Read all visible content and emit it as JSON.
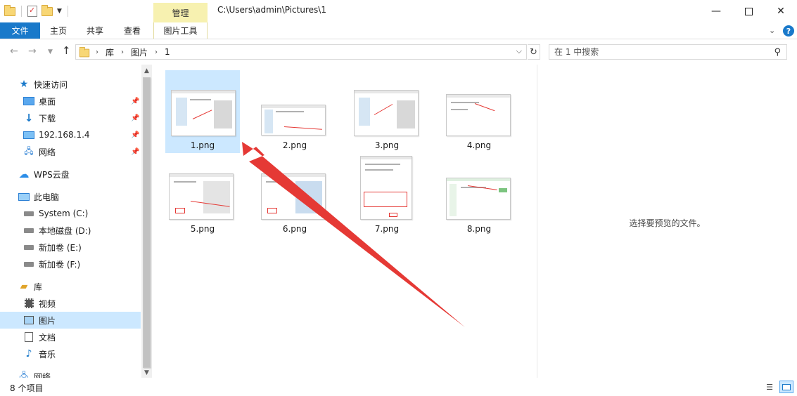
{
  "titlebar": {
    "context_tab_group": "管理",
    "path": "C:\\Users\\admin\\Pictures\\1"
  },
  "ribbon": {
    "tabs": [
      "文件",
      "主页",
      "共享",
      "查看",
      "图片工具"
    ]
  },
  "address": {
    "breadcrumbs": [
      "库",
      "图片",
      "1"
    ],
    "search_placeholder": "在 1 中搜索"
  },
  "sidebar": {
    "items": [
      {
        "label": "快速访问",
        "icon": "star-icon"
      },
      {
        "label": "桌面",
        "icon": "desktop-icon",
        "pinned": true
      },
      {
        "label": "下载",
        "icon": "download-icon",
        "pinned": true
      },
      {
        "label": "192.168.1.4",
        "icon": "network-drive-icon",
        "pinned": true
      },
      {
        "label": "网络",
        "icon": "network-icon",
        "pinned": true
      },
      {
        "label": "WPS云盘",
        "icon": "cloud-icon"
      },
      {
        "label": "此电脑",
        "icon": "computer-icon"
      },
      {
        "label": "System (C:)",
        "icon": "drive-icon"
      },
      {
        "label": "本地磁盘 (D:)",
        "icon": "drive-icon"
      },
      {
        "label": "新加卷 (E:)",
        "icon": "drive-icon"
      },
      {
        "label": "新加卷 (F:)",
        "icon": "drive-icon"
      },
      {
        "label": "库",
        "icon": "library-icon"
      },
      {
        "label": "视频",
        "icon": "video-icon"
      },
      {
        "label": "图片",
        "icon": "pictures-icon",
        "selected": true
      },
      {
        "label": "文档",
        "icon": "documents-icon"
      },
      {
        "label": "音乐",
        "icon": "music-icon"
      },
      {
        "label": "网络",
        "icon": "network-icon"
      }
    ]
  },
  "files": [
    {
      "name": "1.png",
      "selected": true
    },
    {
      "name": "2.png"
    },
    {
      "name": "3.png"
    },
    {
      "name": "4.png"
    },
    {
      "name": "5.png"
    },
    {
      "name": "6.png"
    },
    {
      "name": "7.png"
    },
    {
      "name": "8.png"
    }
  ],
  "preview": {
    "message": "选择要预览的文件。"
  },
  "status": {
    "item_count": "8 个项目"
  },
  "colors": {
    "accent": "#1979ca",
    "selection": "#cce8ff",
    "context_tab": "#f7f1b0",
    "annotation_arrow": "#e53935"
  }
}
